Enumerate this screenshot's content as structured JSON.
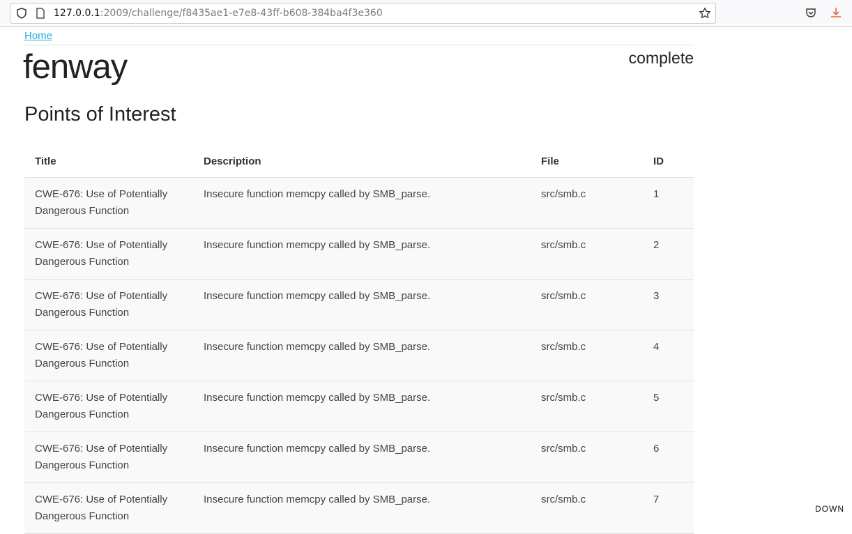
{
  "browser": {
    "url_host": "127.0.0.1",
    "url_rest": ":2009/challenge/f8435ae1-e7e8-43ff-b608-384ba4f3e360"
  },
  "page": {
    "home_link": "Home",
    "title": "fenway",
    "status": "complete",
    "subtitle": "Points of Interest"
  },
  "table": {
    "headers": [
      "Title",
      "Description",
      "File",
      "ID"
    ],
    "rows": [
      {
        "title": "CWE-676: Use of Potentially Dangerous Function",
        "description": "Insecure function memcpy called by SMB_parse.",
        "file": "src/smb.c",
        "id": "1"
      },
      {
        "title": "CWE-676: Use of Potentially Dangerous Function",
        "description": "Insecure function memcpy called by SMB_parse.",
        "file": "src/smb.c",
        "id": "2"
      },
      {
        "title": "CWE-676: Use of Potentially Dangerous Function",
        "description": "Insecure function memcpy called by SMB_parse.",
        "file": "src/smb.c",
        "id": "3"
      },
      {
        "title": "CWE-676: Use of Potentially Dangerous Function",
        "description": "Insecure function memcpy called by SMB_parse.",
        "file": "src/smb.c",
        "id": "4"
      },
      {
        "title": "CWE-676: Use of Potentially Dangerous Function",
        "description": "Insecure function memcpy called by SMB_parse.",
        "file": "src/smb.c",
        "id": "5"
      },
      {
        "title": "CWE-676: Use of Potentially Dangerous Function",
        "description": "Insecure function memcpy called by SMB_parse.",
        "file": "src/smb.c",
        "id": "6"
      },
      {
        "title": "CWE-676: Use of Potentially Dangerous Function",
        "description": "Insecure function memcpy called by SMB_parse.",
        "file": "src/smb.c",
        "id": "7"
      }
    ]
  },
  "overlay": {
    "down_label": "DOWN"
  },
  "colors": {
    "link": "#1eaedb",
    "row_bg": "#f9f9f9",
    "download_icon": "#e66a3a"
  }
}
